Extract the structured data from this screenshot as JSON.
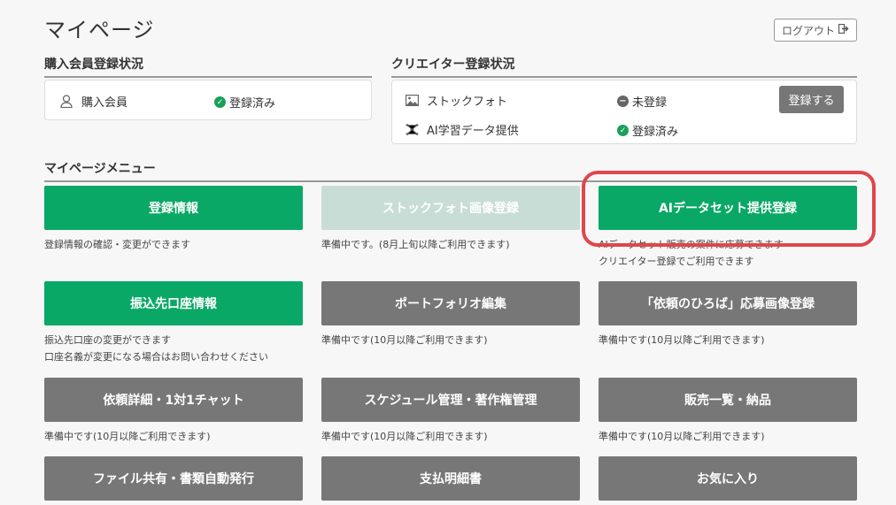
{
  "page": {
    "title": "マイページ",
    "logout_label": "ログアウト"
  },
  "purchase": {
    "heading": "購入会員登録状況",
    "label": "購入会員",
    "status": "登録済み"
  },
  "creator": {
    "heading": "クリエイター登録状況",
    "rows": [
      {
        "label": "ストックフォト",
        "status": "未登録",
        "button": "登録する"
      },
      {
        "label": "AI学習データ提供",
        "status": "登録済み"
      }
    ]
  },
  "menu": {
    "heading": "マイページメニュー",
    "items": [
      {
        "label": "登録情報",
        "desc": [
          "登録情報の確認・変更ができます"
        ]
      },
      {
        "label": "ストックフォト画像登録",
        "desc": [
          "準備中です。(8月上旬以降ご利用できます)"
        ]
      },
      {
        "label": "AIデータセット提供登録",
        "desc": [
          "AIデータセット販売の案件に応募できます",
          "クリエイター登録でご利用できます"
        ]
      },
      {
        "label": "振込先口座情報",
        "desc": [
          "振込先口座の変更ができます",
          "口座名義が変更になる場合はお問い合わせください"
        ]
      },
      {
        "label": "ポートフォリオ編集",
        "desc": [
          "準備中です(10月以降ご利用できます)"
        ]
      },
      {
        "label": "「依頼のひろば」応募画像登録",
        "desc": [
          "準備中です(10月以降ご利用できます)"
        ]
      },
      {
        "label": "依頼詳細・1対1チャット",
        "desc": [
          "準備中です(10月以降ご利用できます)"
        ]
      },
      {
        "label": "スケジュール管理・著作権管理",
        "desc": [
          "準備中です(10月以降ご利用できます)"
        ]
      },
      {
        "label": "販売一覧・納品",
        "desc": [
          "準備中です(10月以降ご利用できます)"
        ]
      },
      {
        "label": "ファイル共有・書類自動発行"
      },
      {
        "label": "支払明細書"
      },
      {
        "label": "お気に入り"
      }
    ]
  },
  "colors": {
    "green": "#0aa866",
    "gray": "#777777",
    "pale_green": "#c8ddd5",
    "highlight": "#e0464a"
  }
}
